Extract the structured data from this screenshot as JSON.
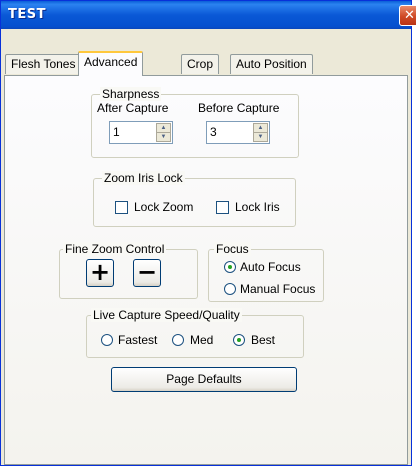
{
  "window": {
    "title": "TEST",
    "close_glyph": "✕"
  },
  "tabs": [
    {
      "label": "Flesh Tones"
    },
    {
      "label": "Advanced"
    },
    {
      "label": "Crop"
    },
    {
      "label": "Auto Position"
    }
  ],
  "active_tab": "Advanced",
  "sharpness": {
    "title": "Sharpness",
    "after_label": "After Capture",
    "after_value": "1",
    "before_label": "Before Capture",
    "before_value": "3"
  },
  "zoom_iris_lock": {
    "title": "Zoom Iris Lock",
    "lock_zoom_label": "Lock Zoom",
    "lock_zoom_checked": false,
    "lock_iris_label": "Lock Iris",
    "lock_iris_checked": false
  },
  "fine_zoom": {
    "title": "Fine Zoom Control",
    "plus_glyph": "+",
    "minus_glyph": "−"
  },
  "focus": {
    "title": "Focus",
    "auto_label": "Auto Focus",
    "manual_label": "Manual Focus",
    "selected": "Auto Focus"
  },
  "live_capture": {
    "title": "Live Capture Speed/Quality",
    "fastest_label": "Fastest",
    "med_label": "Med",
    "best_label": "Best",
    "selected": "Best"
  },
  "page_defaults_label": "Page Defaults",
  "icons": {
    "spin_up": "up-arrow-icon",
    "spin_down": "down-arrow-icon",
    "close": "close-icon"
  }
}
